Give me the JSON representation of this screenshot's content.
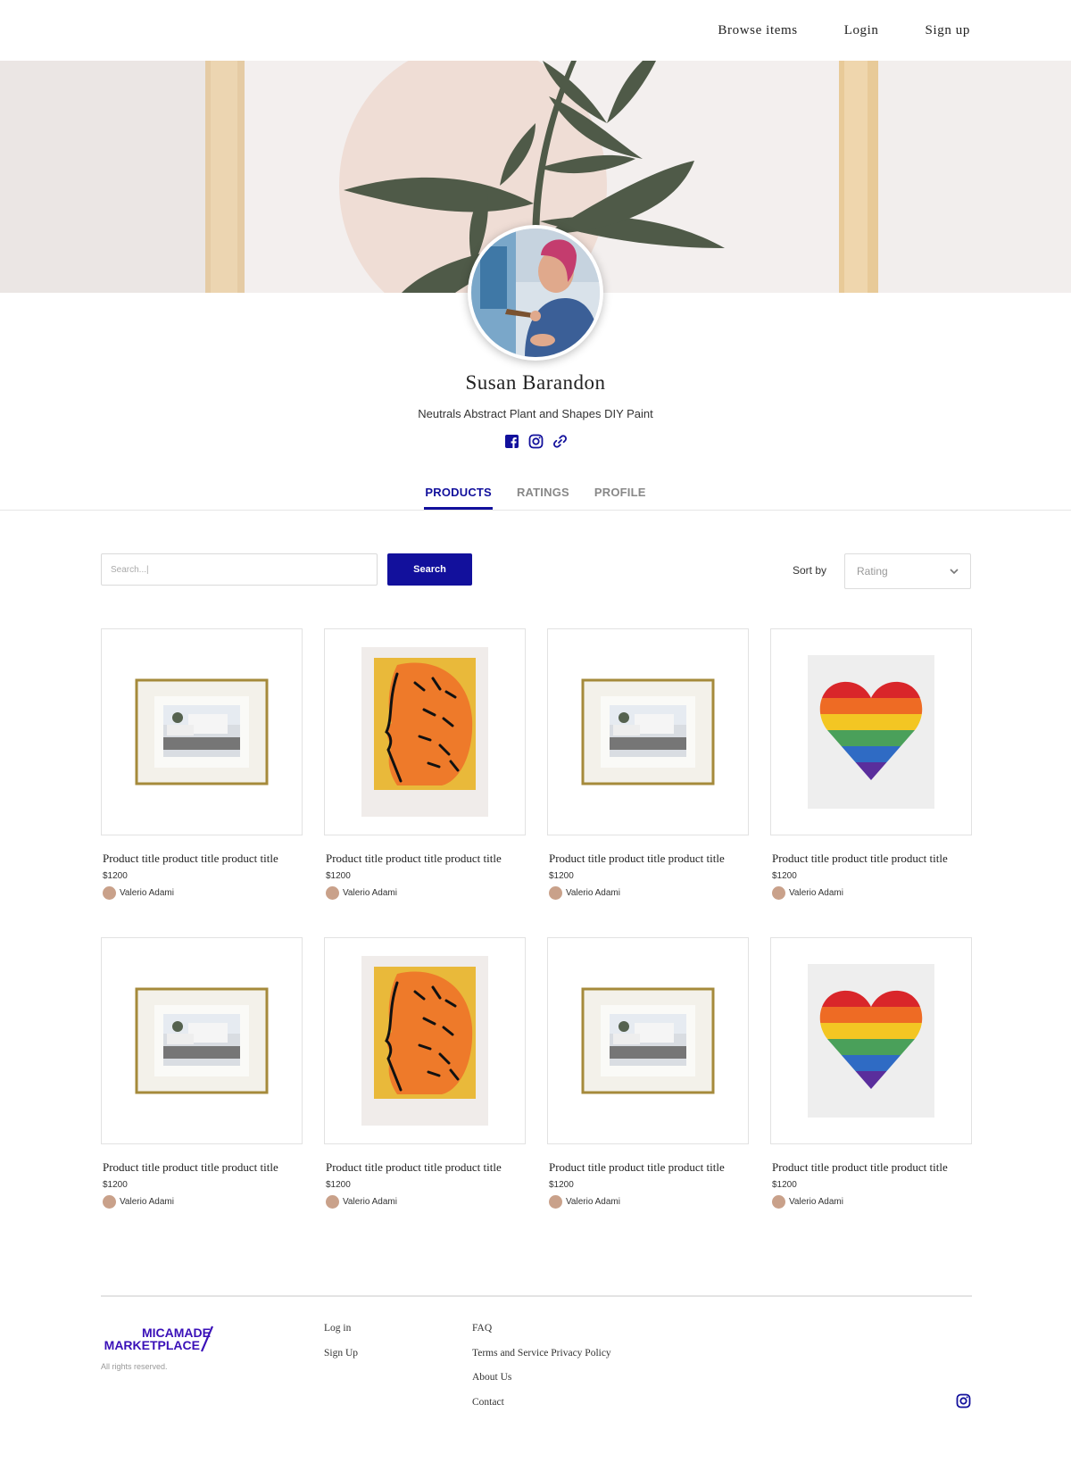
{
  "nav": {
    "browse": "Browse items",
    "login": "Login",
    "signup": "Sign up"
  },
  "profile": {
    "name": "Susan Barandon",
    "tagline": "Neutrals Abstract Plant and Shapes DIY Paint",
    "social_icons": [
      "facebook-icon",
      "instagram-icon",
      "link-icon"
    ]
  },
  "tabs": [
    {
      "label": "PRODUCTS",
      "active": true
    },
    {
      "label": "RATINGS",
      "active": false
    },
    {
      "label": "PROFILE",
      "active": false
    }
  ],
  "toolbar": {
    "search_placeholder": "Search...|",
    "search_button": "Search",
    "sort_label": "Sort by",
    "sort_value": "Rating"
  },
  "products": [
    {
      "title": "Product title product title product title",
      "price": "$1200",
      "seller": "Valerio Adami",
      "image": "framed-photo"
    },
    {
      "title": "Product title product title product title",
      "price": "$1200",
      "seller": "Valerio Adami",
      "image": "orange-portrait"
    },
    {
      "title": "Product title product title product title",
      "price": "$1200",
      "seller": "Valerio Adami",
      "image": "framed-photo"
    },
    {
      "title": "Product title product title product title",
      "price": "$1200",
      "seller": "Valerio Adami",
      "image": "rainbow-heart"
    },
    {
      "title": "Product title product title product title",
      "price": "$1200",
      "seller": "Valerio Adami",
      "image": "framed-photo"
    },
    {
      "title": "Product title product title product title",
      "price": "$1200",
      "seller": "Valerio Adami",
      "image": "orange-portrait"
    },
    {
      "title": "Product title product title product title",
      "price": "$1200",
      "seller": "Valerio Adami",
      "image": "framed-photo"
    },
    {
      "title": "Product title product title product title",
      "price": "$1200",
      "seller": "Valerio Adami",
      "image": "rainbow-heart"
    }
  ],
  "footer": {
    "logo_line1": "MICAMADE",
    "logo_line2": "MARKETPLACE",
    "rights": "All rights reserved.",
    "col1": [
      "Log in",
      "Sign Up"
    ],
    "col2": [
      "FAQ",
      "Terms and Service Privacy Policy",
      "About Us",
      "Contact"
    ]
  },
  "colors": {
    "accent": "#12109c",
    "logo": "#3a10b8"
  }
}
